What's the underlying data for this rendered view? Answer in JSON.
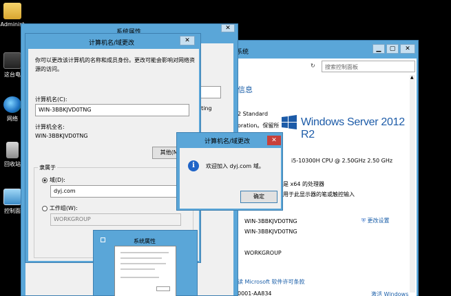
{
  "desktop": {
    "icons": [
      {
        "label": "Administ",
        "name": "folder-icon"
      },
      {
        "label": "这台电",
        "name": "computer-icon"
      },
      {
        "label": "网络",
        "name": "network-icon"
      },
      {
        "label": "回收站",
        "name": "recycle-bin-icon"
      },
      {
        "label": "控制面",
        "name": "control-panel-icon"
      }
    ]
  },
  "system_window": {
    "title": "系统",
    "search_placeholder": "搜索控制面板",
    "heading_fragment": "信息",
    "edition_fragment": "2 Standard",
    "copyright_fragment": "oration。保留所",
    "logo_text": "Windows Server 2012 R2",
    "cpu": "i5-10300H CPU @ 2.50GHz   2.50 GHz",
    "os_type_fragment": "是 x64 的处理器",
    "pen_fragment": "用于此显示器的笔或触控输入",
    "computer_name": "WIN-3BBKJVD0TNG",
    "full_name": "WIN-3BBKJVD0TNG",
    "workgroup": "WORKGROUP",
    "change_settings": "更改设置",
    "license_link": "读 Microsoft 软件许可条款",
    "product_id_fragment": "0001-AA834",
    "activate": "激活 Windows",
    "side_fragment": "nting"
  },
  "sysprop_window": {
    "title": "系统属性"
  },
  "cn_dialog": {
    "title": "计算机名/域更改",
    "intro": "你可以更改该计算机的名称和成员身份。更改可能会影响对网络资源的访问。",
    "computer_name_label": "计算机名(C):",
    "computer_name_value": "WIN-3BBKJVD0TNG",
    "full_name_label": "计算机全名:",
    "full_name_value": "WIN-3BBKJVD0TNG",
    "more_button": "其他(M)...",
    "member_of_label": "隶属于",
    "domain_label": "域(D):",
    "domain_value": "dyj.com",
    "workgroup_label": "工作组(W):",
    "workgroup_value": "WORKGROUP"
  },
  "message_box": {
    "title": "计算机名/域更改",
    "message": "欢迎加入 dyj.com 域。",
    "ok_button": "确定"
  },
  "thumbnail": {
    "title": "系统属性"
  }
}
